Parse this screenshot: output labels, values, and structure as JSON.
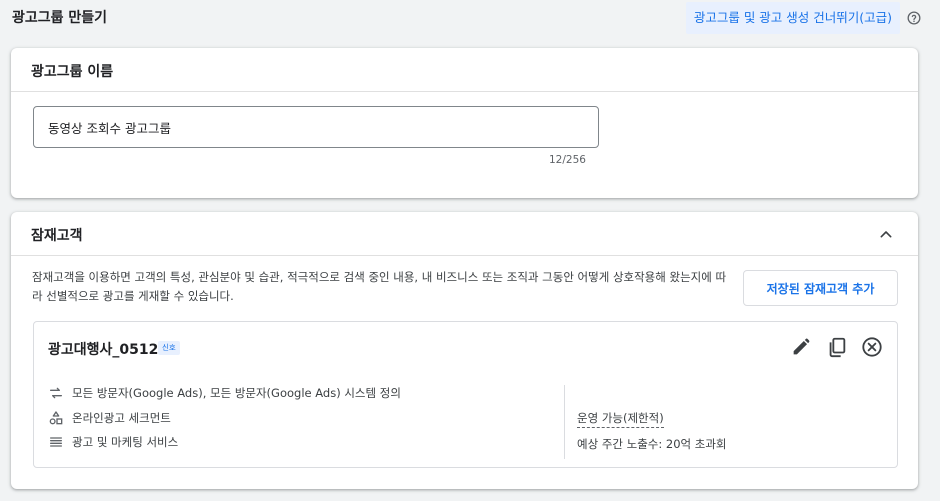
{
  "header": {
    "title": "광고그룹 만들기",
    "skip_label": "광고그룹 및 광고 생성 건너뛰기(고급)",
    "help_icon": "help-circle-icon"
  },
  "ad_group_name": {
    "section_title": "광고그룹 이름",
    "input_value": "동영상 조회수 광고그룹",
    "char_count": "12/256"
  },
  "audience": {
    "section_title": "잠재고객",
    "description": "잠재고객을 이용하면 고객의 특성, 관심분야 및 습관, 적극적으로 검색 중인 내용, 내 비즈니스 또는 조직과 그동안 어떻게 상호작용해 왔는지에 따라 선별적으로 광고를 게재할 수 있습니다.",
    "add_button_label": "저장된 잠재고객 추가",
    "segment": {
      "name": "광고대행사_0512",
      "badge": "신호",
      "rows": [
        {
          "icon": "sync-arrows-icon",
          "text": "모든 방문자(Google Ads), 모든 방문자(Google Ads) 시스템 정의"
        },
        {
          "icon": "shapes-icon",
          "text": "온라인광고 세크먼트"
        },
        {
          "icon": "list-lines-icon",
          "text": "광고 및 마케팅 서비스"
        }
      ],
      "status": "운영 가능(제한적)",
      "reach": "예상 주간 노출수: 20억 초과회"
    }
  },
  "colors": {
    "accent": "#1a73e8",
    "badge_bg": "#e8f0fe",
    "page_bg": "#f1f3f4"
  }
}
